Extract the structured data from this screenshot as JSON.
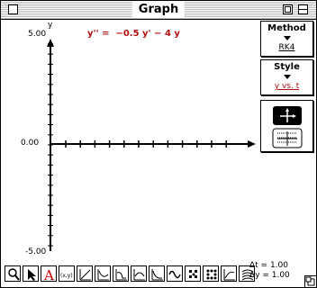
{
  "window": {
    "title": "Graph"
  },
  "equation": "y'' =  −0.5 y' − 4 y",
  "axes": {
    "ylabel": "y",
    "ymax_label": "5.00",
    "yzero_label": "0.00",
    "ymin_label": "-5.00"
  },
  "method": {
    "title": "Method",
    "value": "RK4"
  },
  "style": {
    "title": "Style",
    "value": "y vs. t"
  },
  "view_buttons": [
    "axes-view-icon",
    "phase-grid-icon"
  ],
  "toolbar": [
    "magnify-icon",
    "pointer-icon",
    "text-a-icon",
    "xy-readout-icon",
    "line-tool-icon",
    "solution-curve-icon",
    "slope-field-icon",
    "direction-field-icon",
    "wave-icon",
    "dots-icon",
    "scatter-icon",
    "zoom-curve-icon",
    "layers-icon"
  ],
  "toolbar_labels": {
    "text_a": "A",
    "xy": "(x,y)"
  },
  "deltas": {
    "dt": "Δt = 1.00",
    "dy": "Δy = 1.00"
  },
  "colors": {
    "equation": "#b01010",
    "text_tool": "#cc0000"
  }
}
